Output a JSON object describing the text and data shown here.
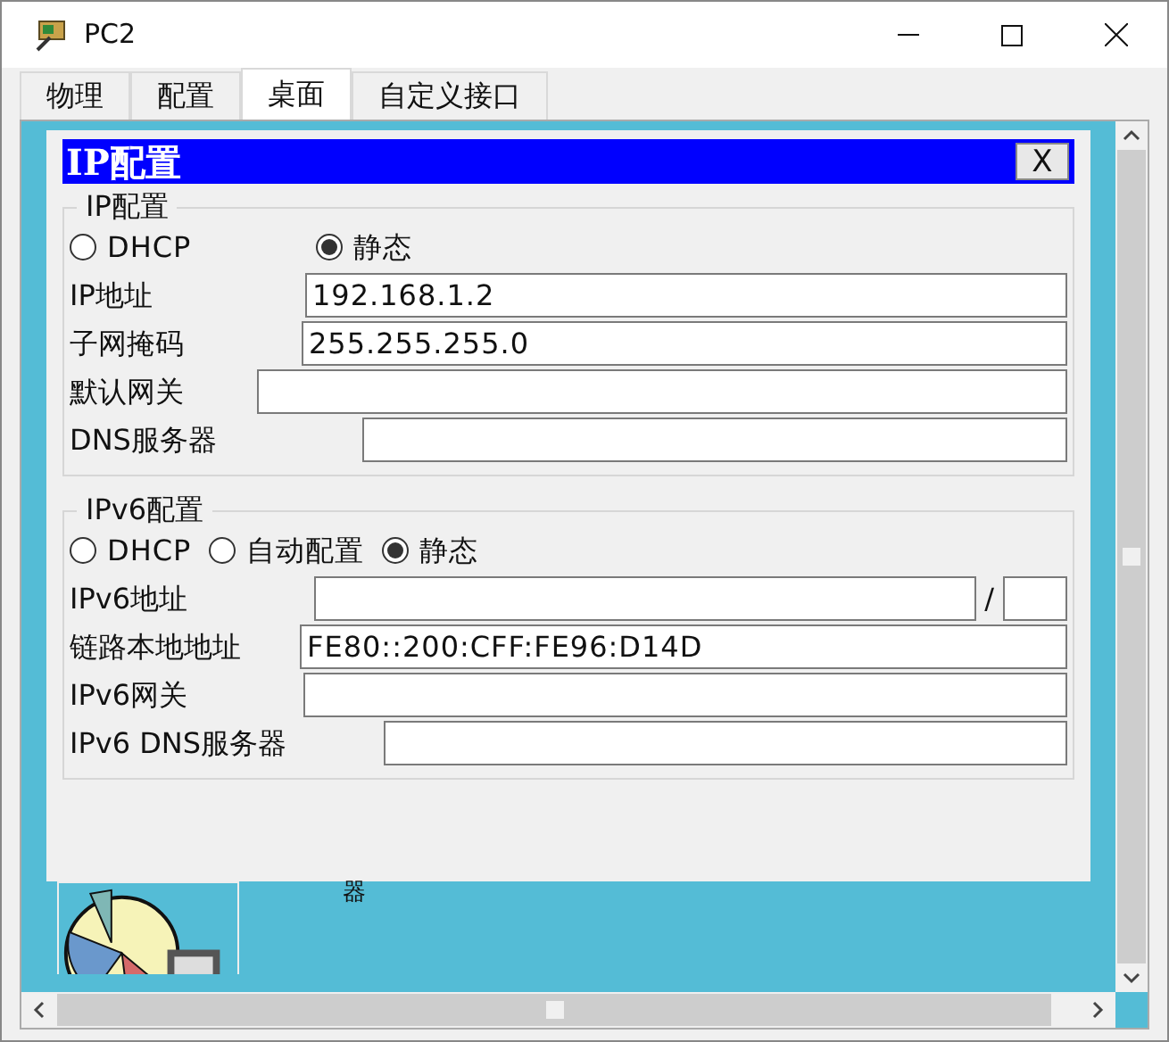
{
  "window": {
    "title": "PC2"
  },
  "tabs": [
    {
      "label": "物理",
      "selected": false
    },
    {
      "label": "配置",
      "selected": false
    },
    {
      "label": "桌面",
      "selected": true
    },
    {
      "label": "自定义接口",
      "selected": false
    }
  ],
  "dialog": {
    "title": "IP配置",
    "close": "X",
    "ipv4": {
      "legend": "IP配置",
      "modes": [
        {
          "label": "DHCP",
          "selected": false
        },
        {
          "label": "静态",
          "selected": true
        }
      ],
      "fields": [
        {
          "label": "IP地址",
          "value": "192.168.1.2"
        },
        {
          "label": "子网掩码",
          "value": "255.255.255.0"
        },
        {
          "label": "默认网关"
        },
        {
          "label": "DNS服务器"
        }
      ]
    },
    "ipv6": {
      "legend": "IPv6配置",
      "modes": [
        {
          "label": "DHCP",
          "selected": false
        },
        {
          "label": "自动配置",
          "selected": false
        },
        {
          "label": "静态",
          "selected": true
        }
      ],
      "fields": [
        {
          "label": "IPv6地址",
          "kind": "prefix",
          "separator": "/"
        },
        {
          "label": "链路本地地址",
          "value": "FE80::200:CFF:FE96:D14D"
        },
        {
          "label": "IPv6网关"
        },
        {
          "label": "IPv6 DNS服务器"
        }
      ]
    }
  },
  "desktop": {
    "icon_label": "器"
  }
}
